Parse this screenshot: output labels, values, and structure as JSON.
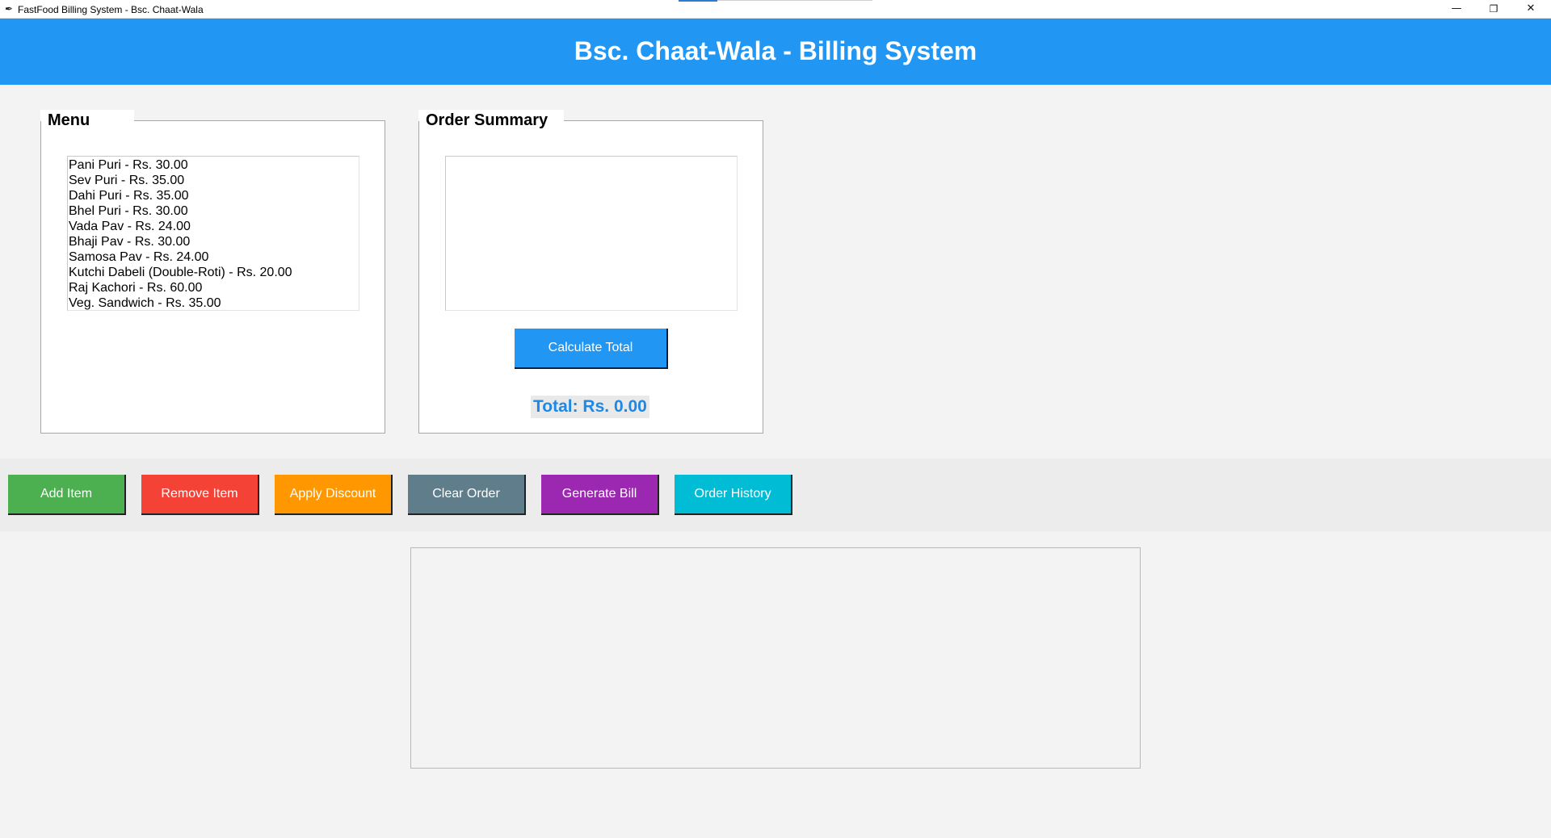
{
  "window": {
    "title": "FastFood Billing System - Bsc. Chaat-Wala",
    "app_icon": "feather-icon",
    "controls": {
      "minimize": "—",
      "restore": "❐",
      "close": "✕"
    }
  },
  "header": {
    "title": "Bsc. Chaat-Wala - Billing System",
    "color": "#2196f3"
  },
  "menu": {
    "label": "Menu",
    "items": [
      "Pani Puri - Rs. 30.00",
      "Sev Puri - Rs. 35.00",
      "Dahi Puri - Rs. 35.00",
      "Bhel Puri - Rs. 30.00",
      "Vada Pav - Rs. 24.00",
      "Bhaji Pav - Rs. 30.00",
      "Samosa Pav - Rs. 24.00",
      "Kutchi Dabeli (Double-Roti) - Rs. 20.00",
      "Raj Kachori - Rs. 60.00",
      "Veg. Sandwich - Rs. 35.00"
    ]
  },
  "order_summary": {
    "label": "Order Summary",
    "items": [],
    "calculate_label": "Calculate Total",
    "total_text": "Total: Rs. 0.00"
  },
  "actions": [
    {
      "label": "Add Item",
      "color": "#4caf50"
    },
    {
      "label": "Remove Item",
      "color": "#f44336"
    },
    {
      "label": "Apply Discount",
      "color": "#ff9800"
    },
    {
      "label": "Clear Order",
      "color": "#607d8b"
    },
    {
      "label": "Generate Bill",
      "color": "#9c27b0"
    },
    {
      "label": "Order History",
      "color": "#00bcd4"
    }
  ],
  "bill_output": {
    "text": ""
  }
}
